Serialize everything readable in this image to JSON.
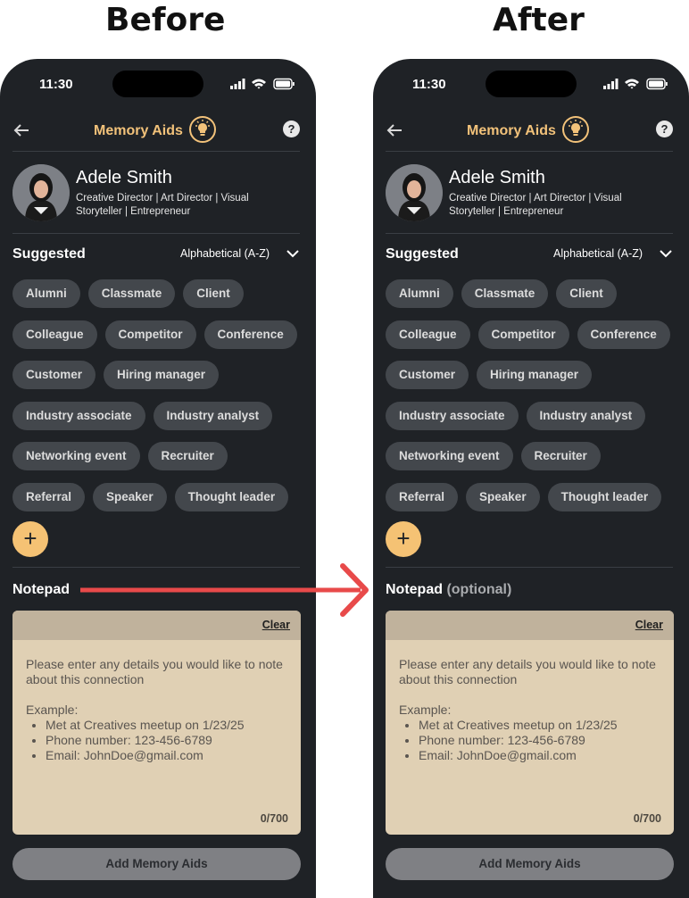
{
  "headings": {
    "before": "Before",
    "after": "After"
  },
  "colors": {
    "background": "#1f2226",
    "accent": "#f5c274",
    "arrow": "#e84a4a",
    "chip": "#43474c",
    "note_card": "#e0d0b4"
  },
  "status": {
    "time": "11:30"
  },
  "nav": {
    "title": "Memory Aids",
    "back_icon": "arrow-left-icon",
    "title_icon": "lightbulb-icon",
    "help": "?"
  },
  "profile": {
    "name": "Adele Smith",
    "bio": "Creative Director | Art Director | Visual Storyteller | Entrepreneur"
  },
  "suggested": {
    "label": "Suggested",
    "sort_value": "Alphabetical (A-Z)"
  },
  "tags": [
    "Alumni",
    "Classmate",
    "Client",
    "Colleague",
    "Competitor",
    "Conference",
    "Customer",
    "Hiring manager",
    "Industry associate",
    "Industry analyst",
    "Networking event",
    "Recruiter",
    "Referral",
    "Speaker",
    "Thought leader"
  ],
  "add_tag": "+",
  "notepad": {
    "label": "Notepad",
    "optional": "(optional)",
    "clear": "Clear",
    "placeholder_line1": "Please enter any details you would like to note about this connection",
    "example_label": "Example:",
    "examples": [
      "Met at Creatives meetup on 1/23/25",
      "Phone number: 123-456-6789",
      "Email: JohnDoe@gmail.com"
    ],
    "counter": "0/700"
  },
  "primary_button": "Add Memory Aids"
}
